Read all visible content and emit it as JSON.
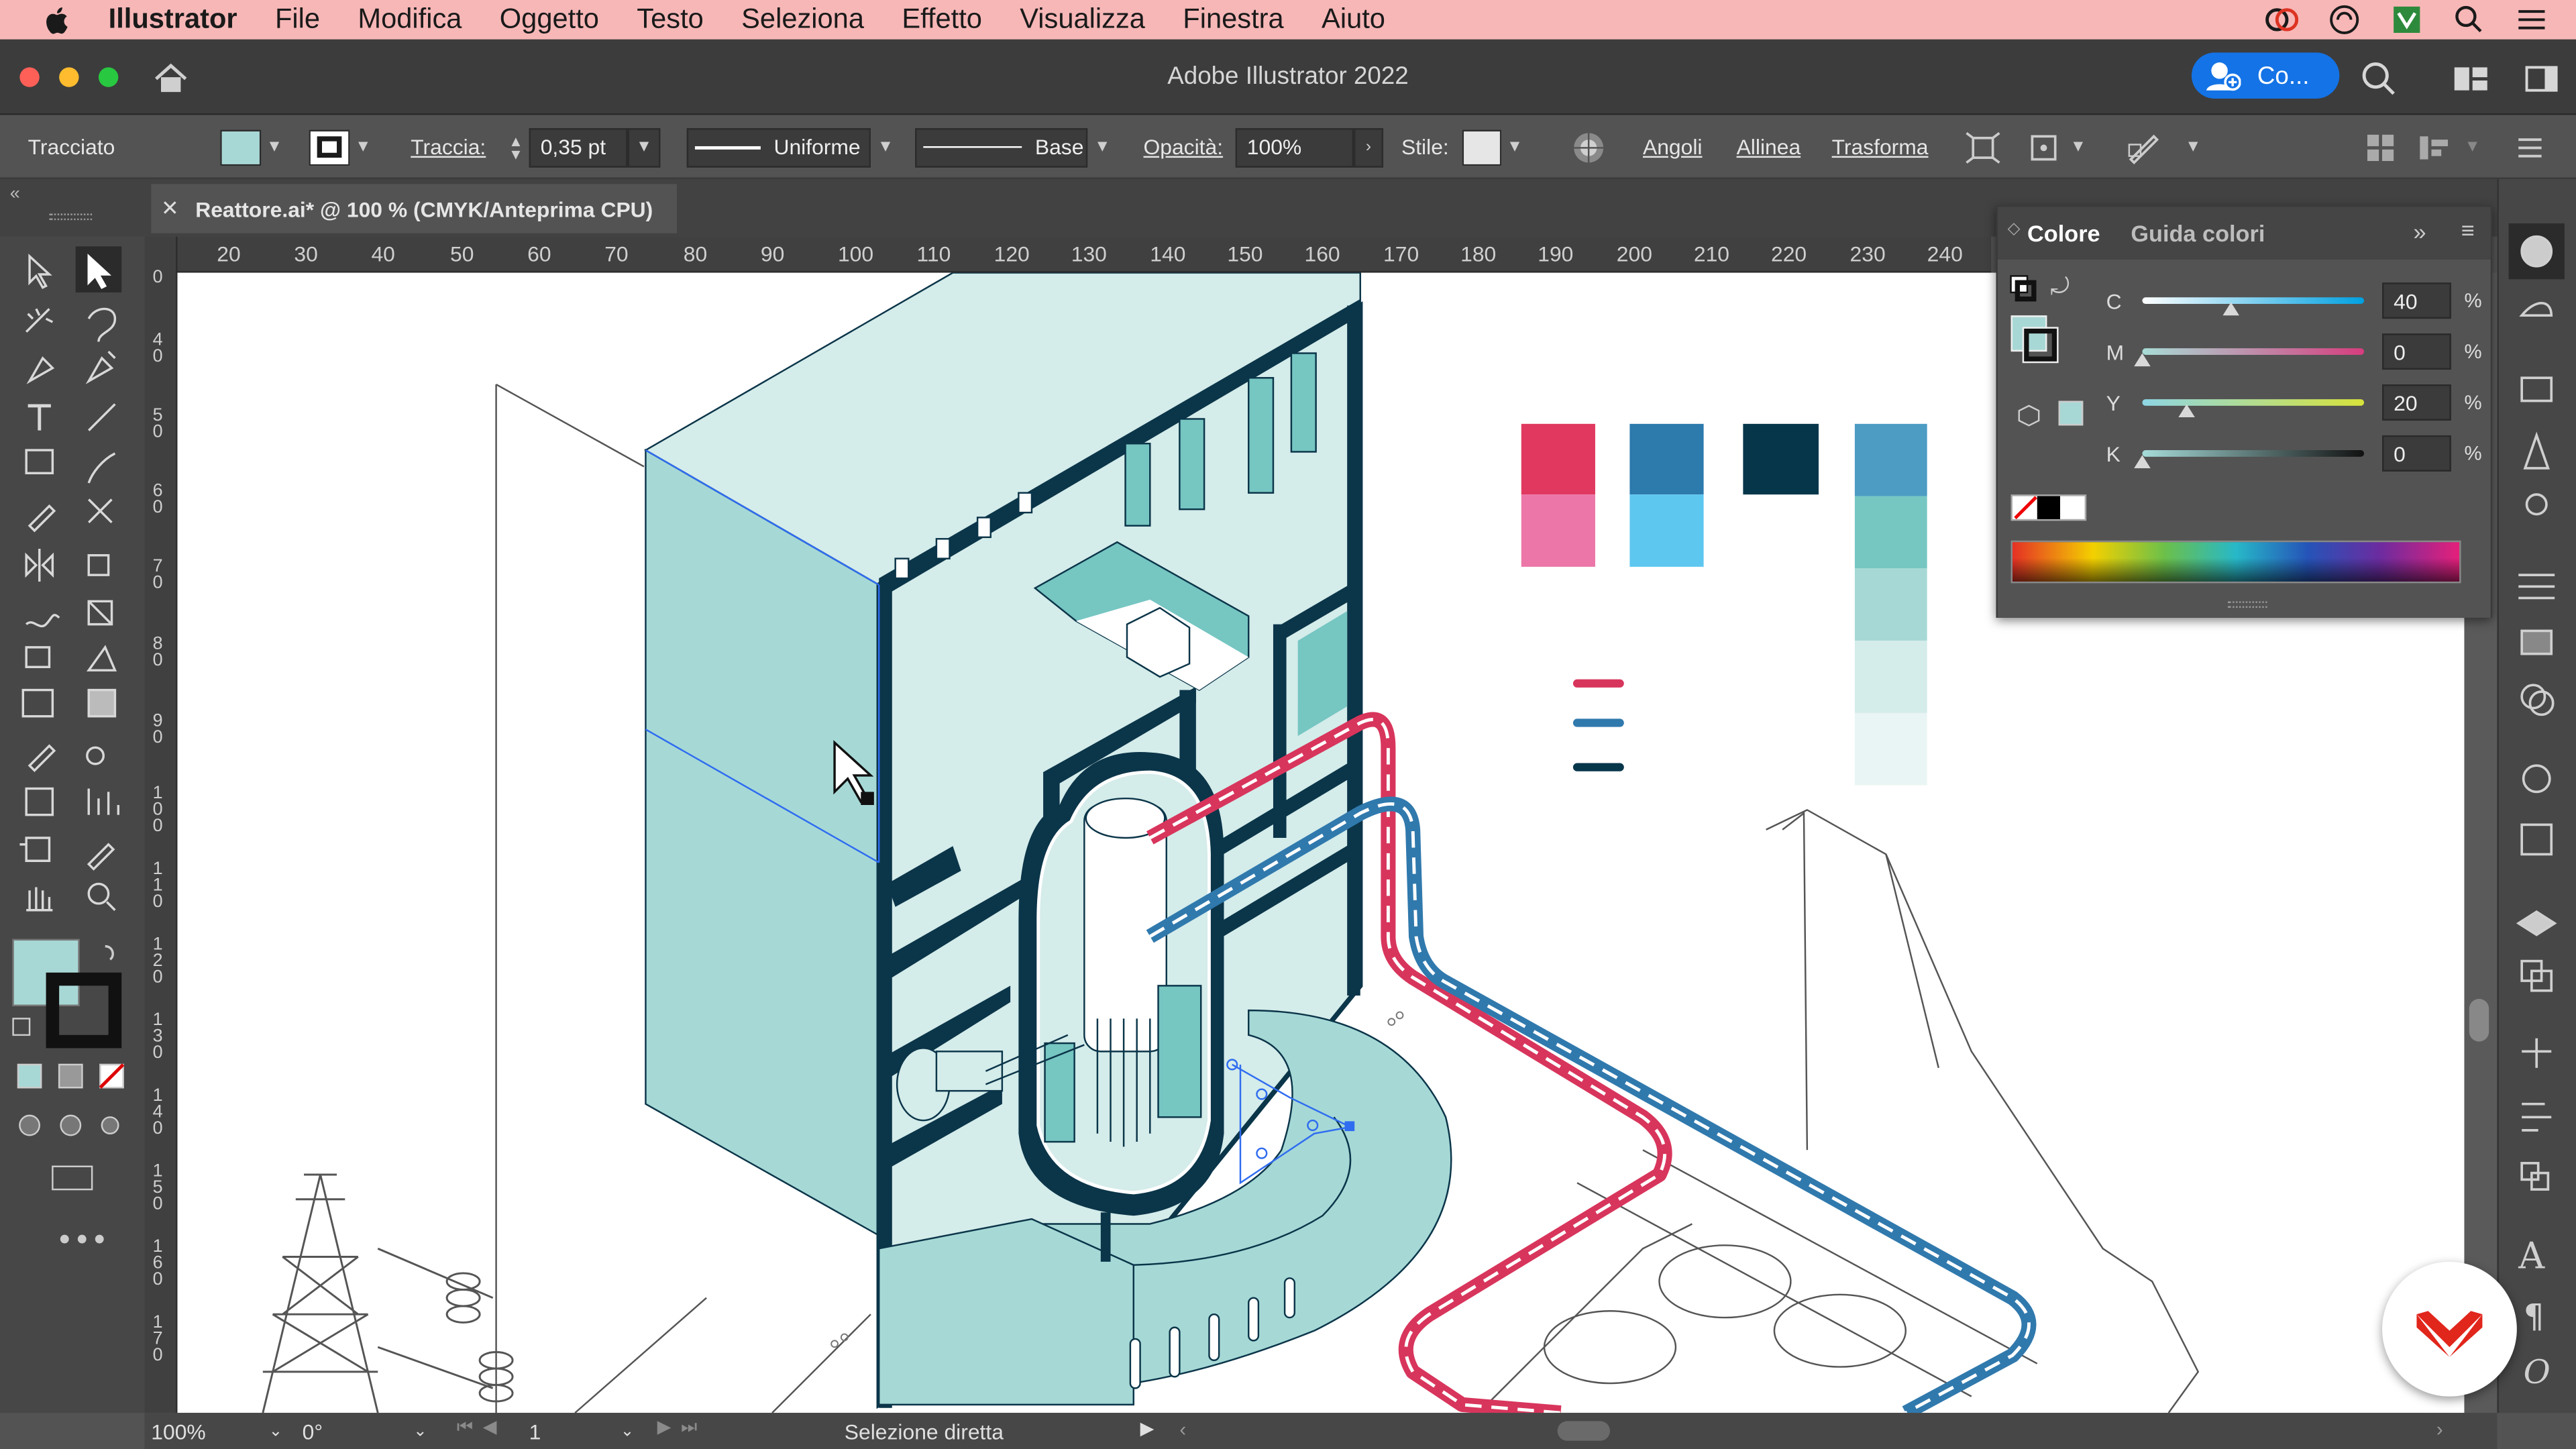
{
  "menubar": {
    "items": [
      "Illustrator",
      "File",
      "Modifica",
      "Oggetto",
      "Testo",
      "Seleziona",
      "Effetto",
      "Visualizza",
      "Finestra",
      "Aiuto"
    ]
  },
  "window": {
    "title": "Adobe Illustrator 2022",
    "cloud_button": "Co..."
  },
  "control_bar": {
    "object_type": "Tracciato",
    "stroke_label": "Traccia:",
    "stroke_weight": "0,35 pt",
    "profile": "Uniforme",
    "brush": "Base",
    "opacity_label": "Opacità:",
    "opacity": "100%",
    "style_label": "Stile:",
    "corners": "Angoli",
    "align": "Allinea",
    "transform": "Trasforma"
  },
  "document_tab": {
    "label": "Reattore.ai* @ 100 % (CMYK/Anteprima CPU)"
  },
  "rulers": {
    "horizontal": [
      "20",
      "30",
      "40",
      "50",
      "60",
      "70",
      "80",
      "90",
      "100",
      "110",
      "120",
      "130",
      "140",
      "150",
      "160",
      "170",
      "180",
      "190",
      "200",
      "210",
      "220",
      "230",
      "240"
    ],
    "vertical": [
      "0",
      "40",
      "50",
      "60",
      "70",
      "80",
      "90",
      "100",
      "110",
      "120",
      "130",
      "140",
      "150",
      "160",
      "170"
    ]
  },
  "color_panel": {
    "tabs": [
      "Colore",
      "Guida colori"
    ],
    "channels": [
      {
        "label": "C",
        "value": "40",
        "level": 0.4,
        "colors": [
          "#ffffff",
          "#00a0e0"
        ]
      },
      {
        "label": "M",
        "value": "0",
        "level": 0.0,
        "colors": [
          "#a8dcd6",
          "#d63d7e"
        ]
      },
      {
        "label": "Y",
        "value": "20",
        "level": 0.2,
        "colors": [
          "#8ed6e4",
          "#d7e23a"
        ]
      },
      {
        "label": "K",
        "value": "0",
        "level": 0.0,
        "colors": [
          "#a6dcd9",
          "#111111"
        ]
      }
    ],
    "percent": "%",
    "fill_color": "#a8d8d5"
  },
  "swatches_on_canvas": {
    "red": [
      "#e0385f",
      "#ec76a8"
    ],
    "blue": [
      "#2d7aad",
      "#5ec7f0"
    ],
    "dark": [
      "#06364a"
    ],
    "teal": [
      "#4c9cc4",
      "#76c6c2",
      "#a6d9d6",
      "#d4ecea",
      "#e9f5f4"
    ]
  },
  "status_bar": {
    "zoom": "100%",
    "rotation": "0°",
    "artboard": "1",
    "tool": "Selezione diretta"
  },
  "colors": {
    "mint": "#a6d9d6",
    "mint_light": "#d4ecea",
    "navy": "#0b3549",
    "red_pipe": "#d8355c",
    "blue_pipe": "#3079ad",
    "menubar": "#f7b7b7",
    "accent": "#1473e6"
  }
}
